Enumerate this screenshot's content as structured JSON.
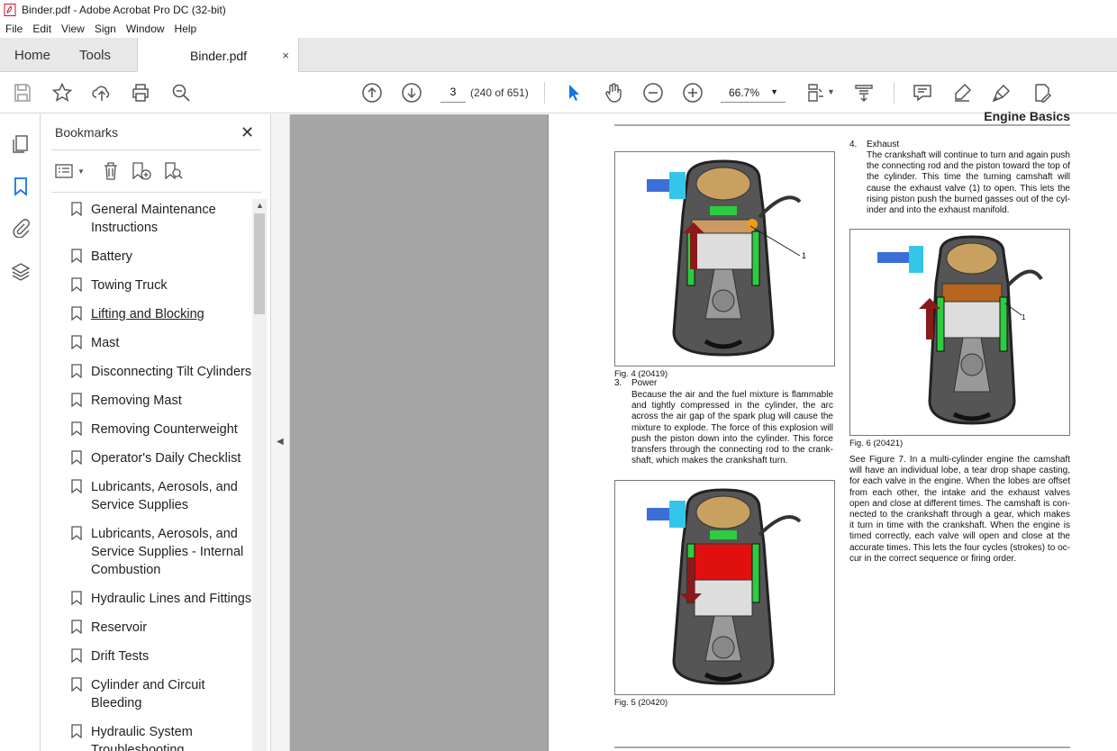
{
  "window": {
    "title": "Binder.pdf - Adobe Acrobat Pro DC (32-bit)"
  },
  "menu": [
    "File",
    "Edit",
    "View",
    "Sign",
    "Window",
    "Help"
  ],
  "tabs": {
    "home": "Home",
    "tools": "Tools",
    "document": "Binder.pdf",
    "close": "×"
  },
  "toolbar": {
    "page_current": "3",
    "page_total": "(240 of 651)",
    "zoom": "66.7%"
  },
  "bookmarks": {
    "title": "Bookmarks",
    "items": [
      "General Maintenance Instructions",
      "Battery",
      "Towing Truck",
      "Lifting and Blocking",
      "Mast",
      "Disconnecting Tilt Cylinders",
      "Removing Mast",
      "Removing Counterweight",
      "Operator's Daily Checklist",
      "Lubricants, Aerosols, and Service Supplies",
      "Lubricants, Aerosols, and Service Supplies - Internal Combustion",
      "Hydraulic Lines and Fittings",
      "Reservoir",
      "Drift Tests",
      "Cylinder and Circuit Bleeding",
      "Hydraulic System Troubleshooting"
    ]
  },
  "page": {
    "header": "Engine Basics",
    "fig4_caption": "Fig. 4 (20419)",
    "fig5_caption": "Fig. 5 (20420)",
    "fig6_caption": "Fig. 6 (20421)",
    "callout_label": "1",
    "step3_num": "3.",
    "step3_title": "Power",
    "step3_body": "Because the air and the fuel mixture is flammable and tightly compressed in the cylinder, the arc across the air gap of the spark plug will cause the mixture to explode. The force of this explosion will push the piston down into the cylinder. This force transfers through the connecting rod to the crank-shaft, which makes the crankshaft turn.",
    "step4_num": "4.",
    "step4_title": "Exhaust",
    "step4_body": "The crankshaft will continue to turn and again push the connecting rod and the piston toward the top of the cylinder. This time the turning camshaft will cause the exhaust valve (1) to open. This lets the rising piston push the burned gasses out of the cyl-inder and into the exhaust manifold.",
    "camshaft_para": "See Figure 7. In a multi-cylinder engine the camshaft will have an individual lobe, a tear drop shape casting, for each valve in the engine. When the lobes are offset from each other, the intake and the exhaust valves open and close at different times. The camshaft is con-nected to the crankshaft through a gear, which makes it turn in time with the crankshaft. When the engine is timed correctly, each valve will open and close at the accurate times. This lets the four cycles (strokes) to oc-cur in the correct sequence or firing order."
  }
}
